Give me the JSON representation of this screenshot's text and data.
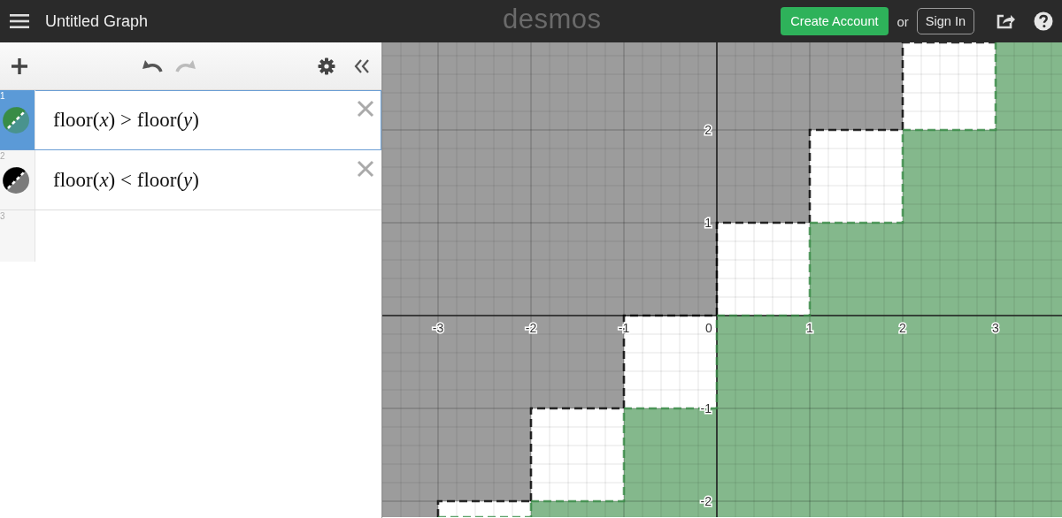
{
  "header": {
    "title": "Untitled Graph",
    "logo": "desmos",
    "create_account": "Create Account",
    "or": "or",
    "sign_in": "Sign In"
  },
  "toolbar": {
    "redo_disabled": true
  },
  "expressions": [
    {
      "number": "1",
      "latex": "floor(*x*) > floor(*y*)",
      "color": "#388c46",
      "selected": true
    },
    {
      "number": "2",
      "latex": "floor(*x*) < floor(*y*)",
      "color": "#000000",
      "selected": false
    },
    {
      "number": "3",
      "selected": false
    }
  ],
  "graph": {
    "x_tick_labels": [
      "-3",
      "-2",
      "-1",
      "0",
      "1",
      "2",
      "3"
    ],
    "y_tick_labels": [
      "2",
      "1",
      "-1",
      "-2"
    ]
  }
}
